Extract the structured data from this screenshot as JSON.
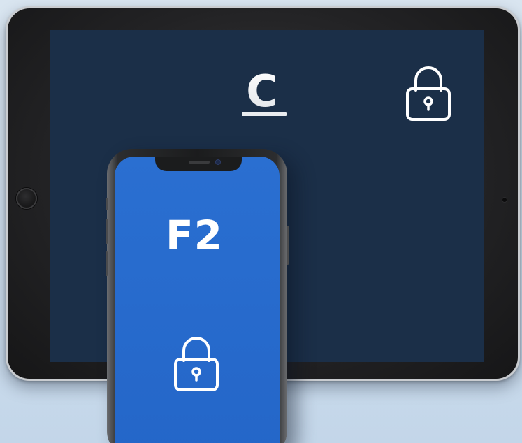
{
  "tablet": {
    "logo_letter": "C",
    "icons": {
      "logo": "c-logo-icon",
      "lock": "lock-icon",
      "home_button": "home-button",
      "camera": "camera-dot"
    },
    "colors": {
      "screen": "#1b2f48",
      "bezel": "#222224",
      "frame": "#c9ccd0"
    }
  },
  "phone": {
    "label": "F2",
    "icons": {
      "lock": "lock-icon",
      "notch": "notch"
    },
    "colors": {
      "screen": "#2a6fd1",
      "frame": "#1b1c1d"
    }
  },
  "colors": {
    "background": "#cfdeec",
    "icon_stroke": "#ffffff"
  }
}
